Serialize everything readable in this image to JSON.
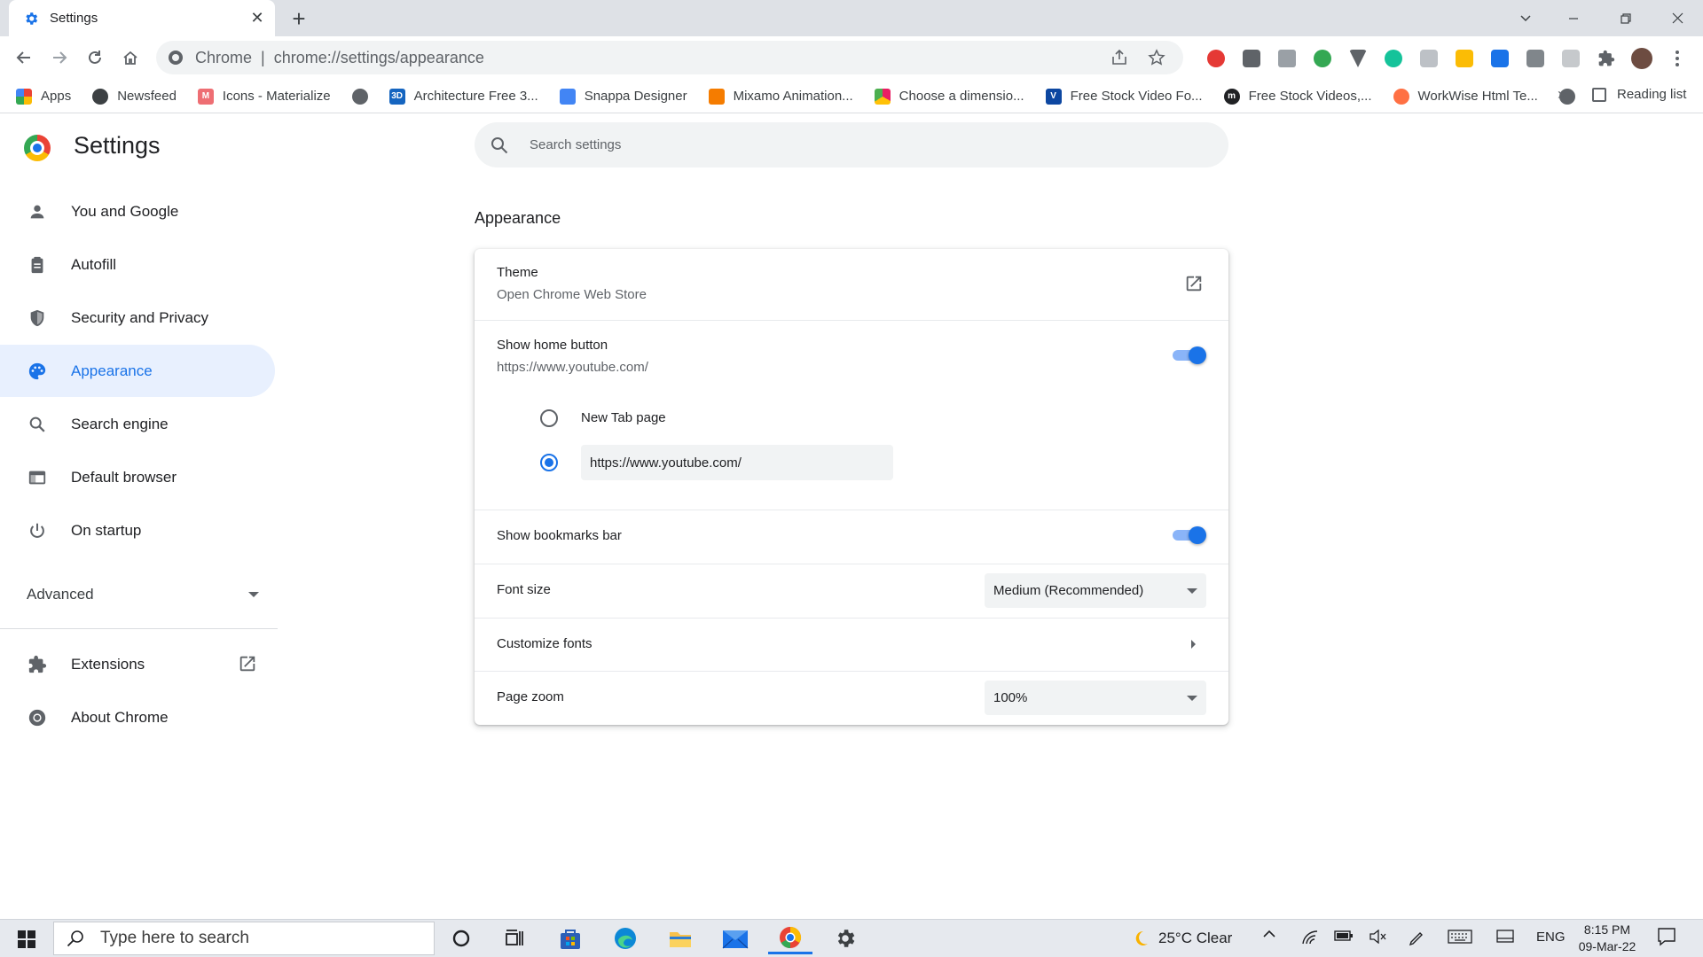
{
  "window": {
    "tab_title": "Settings",
    "tab_close": "✕",
    "new_tab": "+"
  },
  "toolbar": {
    "scheme": "Chrome",
    "separator": "|",
    "url": "chrome://settings/appearance"
  },
  "bookmarks": {
    "items": [
      {
        "label": "Apps",
        "color": "#ea4335"
      },
      {
        "label": "Newsfeed",
        "color": "#3c4043"
      },
      {
        "label": "Icons - Materialize",
        "color": "#ee6e73"
      },
      {
        "label": "",
        "color": "#5f6368"
      },
      {
        "label": "Architecture Free 3...",
        "color": "#1565c0"
      },
      {
        "label": "Snappa Designer",
        "color": "#4285f4"
      },
      {
        "label": "Mixamo Animation...",
        "color": "#f57c00"
      },
      {
        "label": "Choose a dimensio...",
        "color": "#e91e63"
      },
      {
        "label": "Free Stock Video Fo...",
        "color": "#0d47a1"
      },
      {
        "label": "Free Stock Videos,...",
        "color": "#202124"
      },
      {
        "label": "WorkWise Html Te...",
        "color": "#ff7043"
      },
      {
        "label": "",
        "color": "#5f6368"
      }
    ],
    "more": "»",
    "reading_list": "Reading list"
  },
  "settings": {
    "title": "Settings",
    "search_placeholder": "Search settings"
  },
  "sidebar": {
    "items": [
      {
        "label": "You and Google",
        "icon": "person-icon"
      },
      {
        "label": "Autofill",
        "icon": "clipboard-icon"
      },
      {
        "label": "Security and Privacy",
        "icon": "shield-icon"
      },
      {
        "label": "Appearance",
        "icon": "palette-icon",
        "active": true
      },
      {
        "label": "Search engine",
        "icon": "search-icon"
      },
      {
        "label": "Default browser",
        "icon": "browser-icon"
      },
      {
        "label": "On startup",
        "icon": "power-icon"
      }
    ],
    "advanced": "Advanced",
    "extensions": "Extensions",
    "about": "About Chrome"
  },
  "appearance": {
    "section_title": "Appearance",
    "theme": {
      "title": "Theme",
      "subtitle": "Open Chrome Web Store"
    },
    "home_button": {
      "title": "Show home button",
      "subtitle": "https://www.youtube.com/",
      "enabled": true,
      "option_new_tab": "New Tab page",
      "custom_url": "https://www.youtube.com/",
      "selected": "custom"
    },
    "bookmarks_bar": {
      "title": "Show bookmarks bar",
      "enabled": true
    },
    "font_size": {
      "title": "Font size",
      "value": "Medium (Recommended)"
    },
    "customize_fonts": {
      "title": "Customize fonts"
    },
    "page_zoom": {
      "title": "Page zoom",
      "value": "100%"
    }
  },
  "taskbar": {
    "search_placeholder": "Type here to search",
    "weather": "25°C  Clear",
    "language": "ENG",
    "time": "8:15 PM",
    "date": "09-Mar-22"
  },
  "colors": {
    "accent": "#1a73e8",
    "active_bg": "#e8f0fe",
    "toggle_track": "#8ab4f8"
  }
}
